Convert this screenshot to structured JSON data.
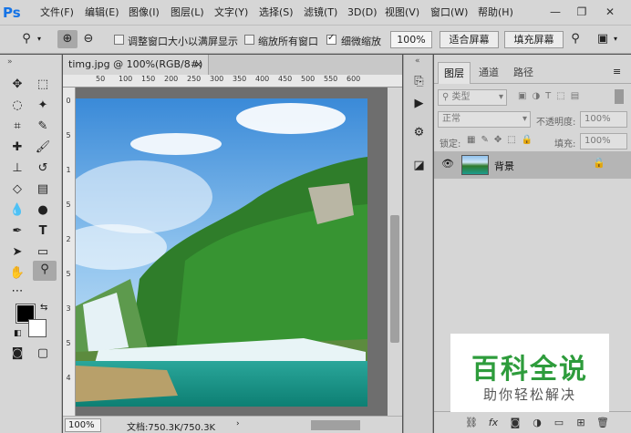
{
  "app": {
    "logo": "Ps"
  },
  "menu": {
    "items": [
      "文件(F)",
      "编辑(E)",
      "图像(I)",
      "图层(L)",
      "文字(Y)",
      "选择(S)",
      "滤镜(T)",
      "3D(D)",
      "视图(V)",
      "窗口(W)",
      "帮助(H)"
    ]
  },
  "window_controls": {
    "minimize": "—",
    "restore": "❐",
    "close": "✕"
  },
  "options": {
    "resize_windows_label": "调整窗口大小以满屏显示",
    "resize_windows_checked": false,
    "zoom_all_label": "缩放所有窗口",
    "zoom_all_checked": false,
    "scrubby_label": "细微缩放",
    "scrubby_checked": true,
    "zoom_value": "100%",
    "fit_screen": "适合屏幕",
    "fill_screen": "填充屏幕"
  },
  "document": {
    "tab_title": "timg.jpg @ 100%(RGB/8#)",
    "tab_close": "×",
    "zoom": "100%",
    "doc_size": "文档:750.3K/750.3K",
    "ruler_top": [
      "50",
      "100",
      "150",
      "200",
      "250",
      "300",
      "350",
      "400",
      "450",
      "500",
      "550",
      "600"
    ],
    "ruler_left": [
      "0",
      "5",
      "1",
      "5",
      "2",
      "5",
      "3",
      "5",
      "4"
    ]
  },
  "layers": {
    "tabs": [
      "图层",
      "通道",
      "路径"
    ],
    "filter_label": "类型",
    "blend_mode": "正常",
    "opacity_label": "不透明度:",
    "opacity_value": "100%",
    "lock_label": "锁定:",
    "fill_label": "填充:",
    "fill_value": "100%",
    "layer_name": "背景"
  },
  "watermark": {
    "title": "百科全说",
    "subtitle": "助你轻松解决"
  }
}
